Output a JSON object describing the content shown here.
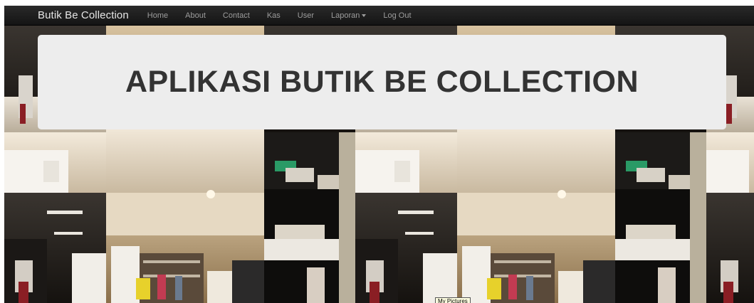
{
  "navbar": {
    "brand": "Butik Be Collection",
    "links": {
      "home": "Home",
      "about": "About",
      "contact": "Contact",
      "kas": "Kas",
      "user": "User",
      "laporan": "Laporan",
      "logout": "Log Out"
    }
  },
  "jumbotron": {
    "title": "APLIKASI BUTIK BE COLLECTION"
  },
  "tooltip": {
    "text": "My Pictures"
  },
  "colors": {
    "navbar": "#1b1b1b",
    "jumbotron": "#ededed",
    "title": "#333333"
  }
}
